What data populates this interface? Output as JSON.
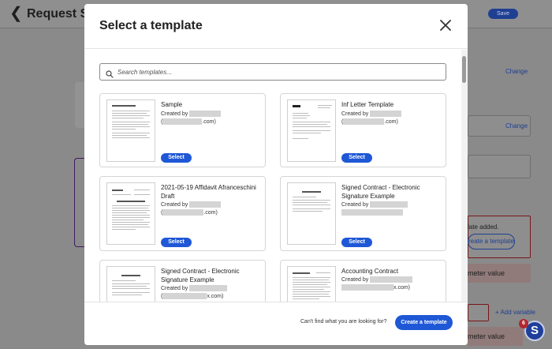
{
  "background": {
    "title": "Request Sig",
    "save_label": "Save",
    "change_label_1": "Change",
    "change_label_2": "Change",
    "template_added_text": "late added.",
    "create_template_pill": "reate a template",
    "parameter_value_1": "meter value",
    "parameter_value_2": "meter value",
    "add_variable": "+ Add variable",
    "badge_count": "6"
  },
  "modal": {
    "title": "Select a template",
    "search_placeholder": "Search templates...",
    "templates": [
      {
        "name": "Sample",
        "created_by": "Created by",
        "email_prefix": "(",
        "email_suffix": ".com)",
        "select_label": "Select"
      },
      {
        "name": "Inf Letter Template",
        "created_by": "Created by",
        "email_prefix": "(",
        "email_suffix": ".com)",
        "select_label": "Select"
      },
      {
        "name": "2021-05-19 Affidavit Afranceschini Draft",
        "created_by": "Created by",
        "email_prefix": "(",
        "email_suffix": ".com)",
        "select_label": "Select"
      },
      {
        "name": "Signed Contract - Electronic Signature Example",
        "created_by": "Created by",
        "email_prefix": "",
        "email_suffix": "",
        "select_label": "Select"
      },
      {
        "name": "Signed Contract - Electronic Signature Example",
        "created_by": "Created by",
        "email_prefix": "(",
        "email_suffix": "x.com)",
        "select_label": "Select"
      },
      {
        "name": "Accounting Contract",
        "created_by": "Created by",
        "email_prefix": "",
        "email_suffix": "x.com)",
        "select_label": "Select"
      }
    ],
    "footer": {
      "prompt": "Can't find what you are looking for?",
      "create_label": "Create a template"
    }
  },
  "colors": {
    "primary": "#1f58d6",
    "overlay_bg": "#8a8a8a"
  }
}
